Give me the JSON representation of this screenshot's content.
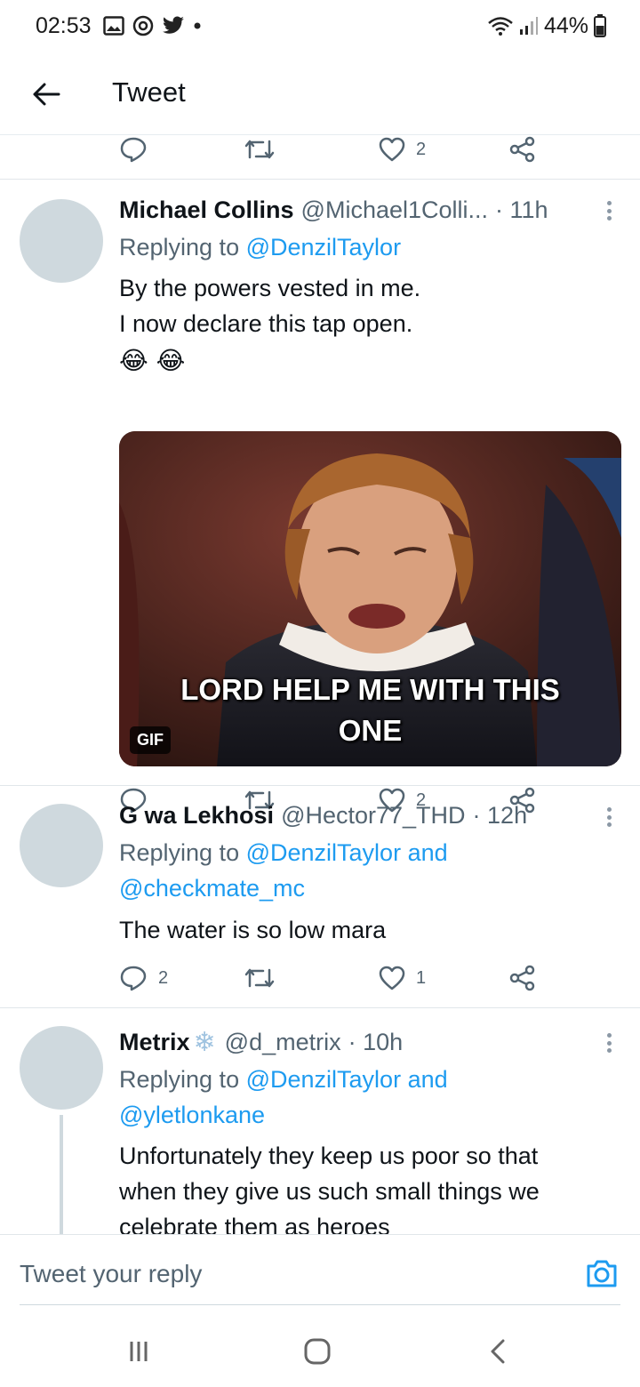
{
  "status_bar": {
    "time": "02:53",
    "left_icons": [
      "image-icon",
      "instagram-icon",
      "twitter-bird-icon",
      "dot-icon"
    ],
    "battery": "44%"
  },
  "header": {
    "title": "Tweet"
  },
  "top_actions": {
    "like_count": "2"
  },
  "tweets": [
    {
      "name": "Michael Collins",
      "handle": "@Michael1Colli...",
      "time": "· 11h",
      "replying_prefix": "Replying to",
      "replying_to": "@DenzilTaylor",
      "text_lines": [
        "By the powers vested in me.",
        "I now declare this tap open."
      ],
      "emojis": "😂 😂",
      "gif": {
        "caption_line1": "LORD HELP ME WITH THIS",
        "caption_line2": "ONE",
        "badge": "GIF"
      },
      "like_count": "2"
    },
    {
      "name": "G wa Lekhosi",
      "handle": "@Hector77_THD",
      "time": "· 12h",
      "replying_prefix": "Replying to",
      "replying_to": "@DenzilTaylor and",
      "replying_to_line2": "@checkmate_mc",
      "text": "The water is so low mara",
      "reply_count": "2",
      "like_count": "1"
    },
    {
      "name": "Metrix",
      "name_emoji": "❄",
      "handle": "@d_metrix",
      "time": "· 10h",
      "replying_prefix": "Replying to",
      "replying_to": "@DenzilTaylor and",
      "replying_to_line2": "@yletlonkane",
      "text_lines": [
        "Unfortunately they keep us poor so that",
        "when they give us such small things we",
        "celebrate them as heroes"
      ]
    }
  ],
  "composer": {
    "placeholder": "Tweet your reply"
  },
  "colors": {
    "accent": "#1d9bf0",
    "secondary_text": "#536471",
    "avatar_placeholder": "#cfd9de"
  }
}
